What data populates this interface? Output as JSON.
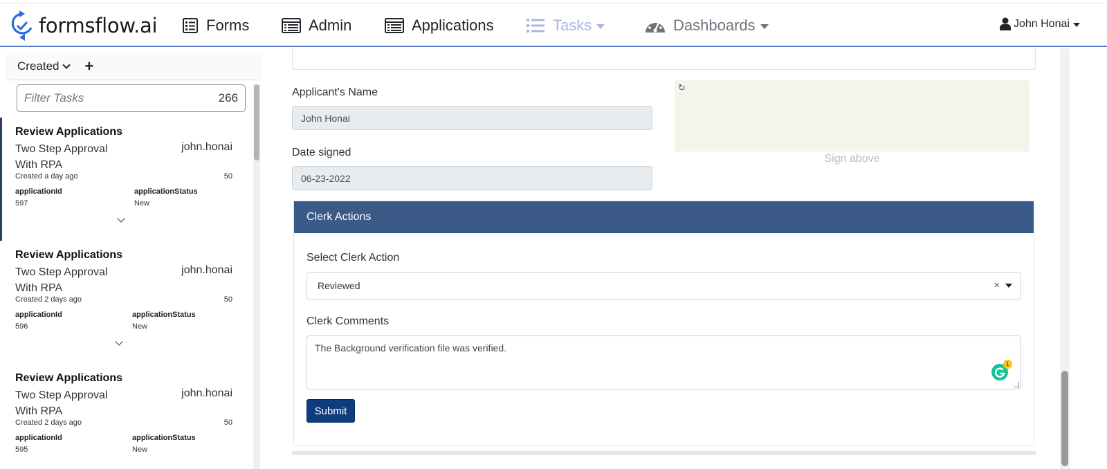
{
  "header": {
    "brand": "formsflow.ai",
    "nav": [
      {
        "label": "Forms",
        "icon": "forms-icon"
      },
      {
        "label": "Admin",
        "icon": "admin-icon"
      },
      {
        "label": "Applications",
        "icon": "applications-icon"
      },
      {
        "label": "Tasks",
        "icon": "tasks-list-icon",
        "active": true
      },
      {
        "label": "Dashboards",
        "icon": "dashboard-gauge-icon"
      }
    ],
    "user": "John Honai"
  },
  "sidebar": {
    "sort_label": "Created",
    "filter": {
      "placeholder": "Filter Tasks",
      "count": "266"
    },
    "tasks": [
      {
        "title": "Review Applications",
        "process": "Two Step Approval With RPA",
        "assignee": "john.honai",
        "created": "Created a day ago",
        "priority": "50",
        "key1": "applicationId",
        "value1": "597",
        "key2": "applicationStatus",
        "value2": "New"
      },
      {
        "title": "Review Applications",
        "process": "Two Step Approval With RPA",
        "assignee": "john.honai",
        "created": "Created 2 days ago",
        "priority": "50",
        "key1": "applicationId",
        "value1": "596",
        "key2": "applicationStatus",
        "value2": "New"
      },
      {
        "title": "Review Applications",
        "process": "Two Step Approval With RPA",
        "assignee": "john.honai",
        "created": "Created 2 days ago",
        "priority": "50",
        "key1": "applicationId",
        "value1": "595",
        "key2": "applicationStatus",
        "value2": "New"
      }
    ]
  },
  "form": {
    "applicant_label": "Applicant's Name",
    "applicant_value": "John Honai",
    "date_label": "Date signed",
    "date_value": "06-23-2022",
    "signature_caption": "Sign above",
    "clerk": {
      "panel_title": "Clerk Actions",
      "action_label": "Select Clerk Action",
      "action_value": "Reviewed",
      "comments_label": "Clerk Comments",
      "comments_value": "The Background verification file was verified.",
      "grammarly_count": "1",
      "submit_label": "Submit"
    }
  },
  "colors": {
    "panel_header": "#3b5a88",
    "submit": "#0d3d7c",
    "active_nav": "#a8b7e0",
    "signature_pad": "#f5f4eb"
  }
}
